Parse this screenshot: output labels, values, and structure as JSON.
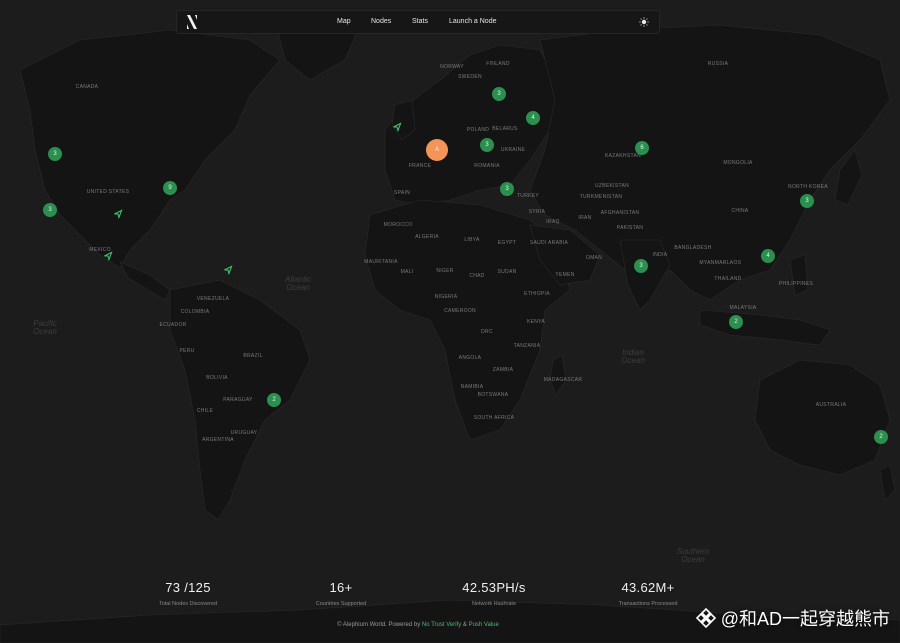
{
  "nav": {
    "items": [
      "Map",
      "Nodes",
      "Stats",
      "Launch a Node"
    ],
    "logo_icon": "alephium-logo-icon",
    "theme_icon": "sun-icon"
  },
  "map": {
    "countries": [
      "RUSSIA",
      "CANADA",
      "UNITED STATES",
      "MEXICO",
      "BRAZIL",
      "VENEZUELA",
      "COLOMBIA",
      "PERU",
      "BOLIVIA",
      "CHILE",
      "ARGENTINA",
      "PARAGUAY",
      "URUGUAY",
      "ECUADOR",
      "SPAIN",
      "FRANCE",
      "POLAND",
      "BELARUS",
      "UKRAINE",
      "ROMANIA",
      "TURKEY",
      "SYRIA",
      "IRAQ",
      "IRAN",
      "EGYPT",
      "LIBYA",
      "ALGERIA",
      "MOROCCO",
      "MAURITANIA",
      "MALI",
      "NIGER",
      "CHAD",
      "SUDAN",
      "ETHIOPIA",
      "NIGERIA",
      "CAMEROON",
      "DRC",
      "KENYA",
      "TANZANIA",
      "ANGOLA",
      "ZAMBIA",
      "NAMIBIA",
      "BOTSWANA",
      "SOUTH AFRICA",
      "MADAGASCAR",
      "SAUDI ARABIA",
      "YEMEN",
      "OMAN",
      "AFGHANISTAN",
      "PAKISTAN",
      "INDIA",
      "KAZAKHSTAN",
      "UZBEKISTAN",
      "TURKMENISTAN",
      "MONGOLIA",
      "CHINA",
      "NORTH KOREA",
      "MYANMAR",
      "THAILAND",
      "LAOS",
      "BANGLADESH",
      "PHILIPPINES",
      "MALAYSIA",
      "AUSTRALIA",
      "SWEDEN",
      "NORWAY",
      "FINLAND"
    ],
    "oceans": [
      "Atlantic Ocean",
      "Pacific Ocean",
      "Indian Ocean",
      "Southern Ocean"
    ],
    "clusters": [
      "3",
      "3",
      "9",
      "3",
      "4",
      "3",
      "3",
      "6",
      "3",
      "3",
      "2",
      "4",
      "3",
      "2",
      "2",
      "2"
    ],
    "featured_cluster": "A"
  },
  "stats": [
    {
      "value": "73 /125",
      "label": "Total Nodes Discovered"
    },
    {
      "value": "16+",
      "label": "Countries Supported"
    },
    {
      "value": "42.53PH/s",
      "label": "Network Hashrate"
    },
    {
      "value": "43.62M+",
      "label": "Transactions Processed"
    }
  ],
  "footer": {
    "prefix": "© Alephium World. Powered by",
    "link1": "No Trust Verify",
    "amp": "&",
    "link2": "Push Value"
  },
  "watermark": {
    "text": "@和AD一起穿越熊市",
    "icon": "binance-square-icon"
  },
  "colors": {
    "background": "#1c1c1c",
    "land": "#141414",
    "cluster": "#2b8f4f",
    "featured": "#f39557",
    "accent": "#4fb971"
  }
}
